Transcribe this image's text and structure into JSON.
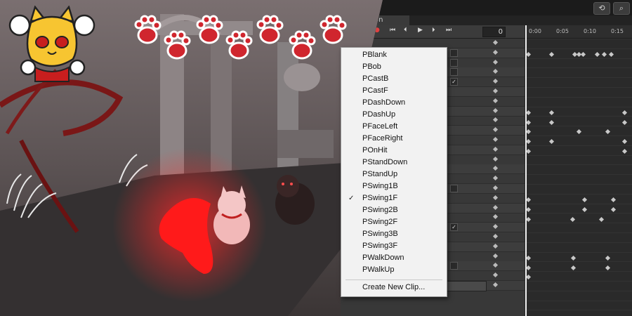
{
  "topbar": {
    "history_icon": "history-icon",
    "search_icon": "search-icon"
  },
  "animation_window": {
    "tab_label": "on",
    "frame_value": "0",
    "ruler_labels": [
      "0:00",
      "0:05",
      "0:10",
      "0:15"
    ],
    "controls": [
      "record-icon",
      "first-key-icon",
      "prev-key-icon",
      "play-icon",
      "next-key-icon",
      "last-key-icon"
    ]
  },
  "clip_menu": {
    "items": [
      {
        "label": "PBlank",
        "checked": false
      },
      {
        "label": "PBob",
        "checked": false
      },
      {
        "label": "PCastB",
        "checked": false
      },
      {
        "label": "PCastF",
        "checked": false
      },
      {
        "label": "PDashDown",
        "checked": false
      },
      {
        "label": "PDashUp",
        "checked": false
      },
      {
        "label": "PFaceLeft",
        "checked": false
      },
      {
        "label": "PFaceRight",
        "checked": false
      },
      {
        "label": "POnHit",
        "checked": false
      },
      {
        "label": "PStandDown",
        "checked": false
      },
      {
        "label": "PStandUp",
        "checked": false
      },
      {
        "label": "PSwing1B",
        "checked": false
      },
      {
        "label": "PSwing1F",
        "checked": true
      },
      {
        "label": "PSwing2B",
        "checked": false
      },
      {
        "label": "PSwing2F",
        "checked": false
      },
      {
        "label": "PSwing3B",
        "checked": false
      },
      {
        "label": "PSwing3F",
        "checked": false
      },
      {
        "label": "PWalkDown",
        "checked": false
      },
      {
        "label": "PWalkUp",
        "checked": false
      }
    ],
    "create_label": "Create New Clip..."
  },
  "colors": {
    "menu_bg": "#f2f2f2",
    "editor_bg": "#2b2b2b",
    "paw_red": "#d0262e",
    "cat_yellow": "#f7c531",
    "scene_red": "#ff1a1a"
  }
}
